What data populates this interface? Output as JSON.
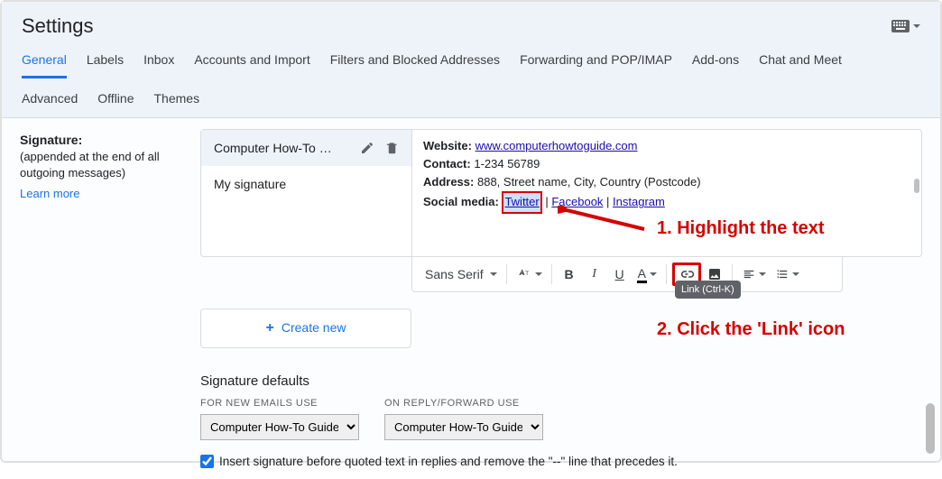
{
  "page_title": "Settings",
  "tabs_primary": [
    "General",
    "Labels",
    "Inbox",
    "Accounts and Import",
    "Filters and Blocked Addresses",
    "Forwarding and POP/IMAP",
    "Add-ons",
    "Chat and Meet"
  ],
  "tabs_secondary": [
    "Advanced",
    "Offline",
    "Themes"
  ],
  "active_tab": "General",
  "signature": {
    "label": "Signature:",
    "desc": "(appended at the end of all outgoing messages)",
    "learn_more": "Learn more",
    "items": [
      "Computer How-To Gui…",
      "My signature"
    ],
    "preview": {
      "website_label": "Website:",
      "website_link": "www.computerhowtoguide.com",
      "contact_label": "Contact:",
      "contact_value": "1-234 56789",
      "address_label": "Address:",
      "address_value": "888, Street name, City, Country (Postcode)",
      "social_label": "Social media:",
      "twitter": "Twitter",
      "facebook": "Facebook",
      "instagram": "Instagram",
      "sep": " | "
    },
    "create_new": "Create new"
  },
  "toolbar": {
    "font": "Sans Serif",
    "tooltip": "Link (Ctrl-K)"
  },
  "defaults": {
    "heading": "Signature defaults",
    "new_label": "FOR NEW EMAILS USE",
    "reply_label": "ON REPLY/FORWARD USE",
    "new_value": "Computer How-To Guide",
    "reply_value": "Computer How-To Guide"
  },
  "checkline": "Insert signature before quoted text in replies and remove the \"--\" line that precedes it.",
  "annotations": {
    "a1": "1. Highlight the text",
    "a2": "2. Click the 'Link' icon"
  }
}
